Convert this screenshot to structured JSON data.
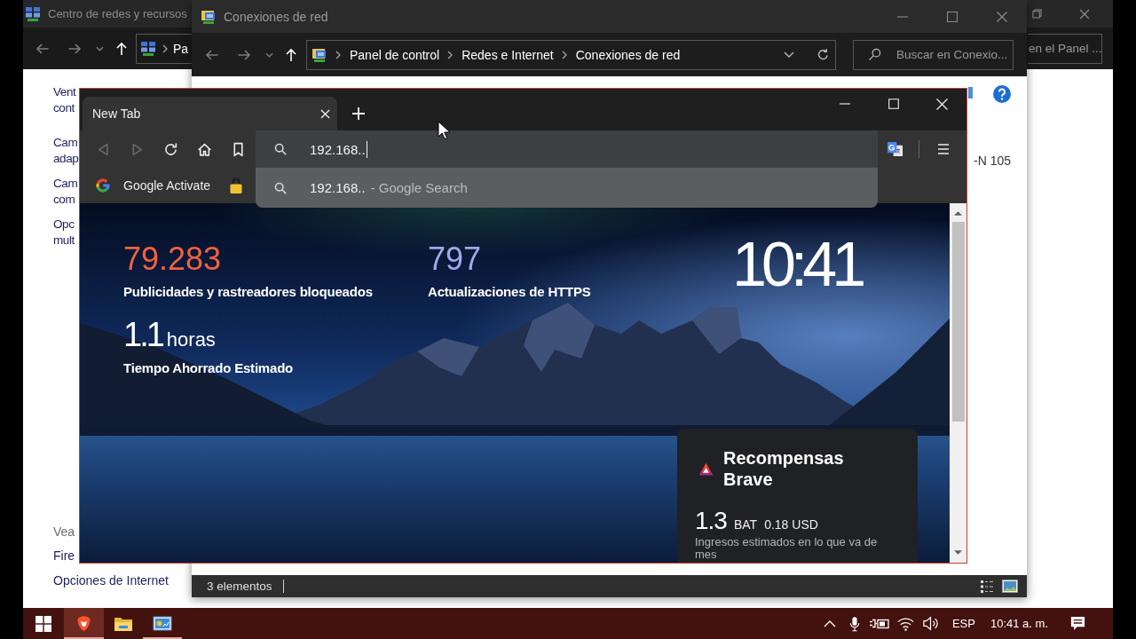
{
  "network_center_window": {
    "title": "Centro de redes y recursos",
    "nav": [
      {
        "kind": "back",
        "disabled": true
      },
      {
        "kind": "forward",
        "disabled": true
      },
      {
        "kind": "recent",
        "disabled": true
      },
      {
        "kind": "up",
        "disabled": false
      }
    ],
    "breadcrumb": [
      "Pa"
    ],
    "search_placeholder": "en el Panel ...",
    "links": [
      {
        "lines": [
          "Vent",
          "cont"
        ]
      },
      {
        "lines": [
          "Cam",
          "adap"
        ]
      },
      {
        "lines": [
          "Cam",
          "com"
        ]
      },
      {
        "lines": [
          "Opc",
          "mult"
        ]
      }
    ],
    "see_also": {
      "heading": "Vea",
      "links": [
        "Fire",
        "Opciones de Internet"
      ]
    }
  },
  "connections_window": {
    "title": "Conexiones de red",
    "nav": [
      {
        "kind": "back",
        "disabled": true
      },
      {
        "kind": "forward",
        "disabled": true
      },
      {
        "kind": "recent",
        "disabled": true
      },
      {
        "kind": "up",
        "disabled": false
      }
    ],
    "breadcrumb": [
      "Panel de control",
      "Redes e Internet",
      "Conexiones de red"
    ],
    "search_placeholder": "Buscar en Conexio...",
    "item_text": "-N 105",
    "status": "3 elementos"
  },
  "browser": {
    "tabs": [
      {
        "label": "New Tab",
        "selected": true
      }
    ],
    "toolbar": [
      {
        "kind": "back",
        "disabled": true
      },
      {
        "kind": "forward",
        "disabled": true
      },
      {
        "kind": "reload",
        "disabled": false
      },
      {
        "kind": "home",
        "disabled": false
      },
      {
        "kind": "bookmark",
        "disabled": false
      }
    ],
    "address": {
      "value": "192.168.."
    },
    "suggestions": [
      {
        "query": "192.168..",
        "source": "- Google Search"
      }
    ],
    "bookmarks": [
      {
        "kind": "google",
        "label": "Google Activate"
      },
      {
        "kind": "lock"
      }
    ],
    "new_tab_page": {
      "stats": [
        {
          "value": "79.283",
          "label": "Publicidades y rastreadores bloqueados",
          "color": "#f0613f"
        },
        {
          "value": "797",
          "label": "Actualizaciones de HTTPS",
          "color": "#a3a7e8"
        }
      ],
      "time_saved": {
        "value": "1.1",
        "unit": "horas",
        "label": "Tiempo Ahorrado Estimado"
      },
      "clock": "10:41",
      "rewards": {
        "title": "Recompensas Brave",
        "balance": "1.3",
        "currency": "BAT",
        "fiat": "0.18 USD",
        "note": "Ingresos estimados en lo que va de mes"
      }
    }
  },
  "taskbar": {
    "apps": [
      {
        "kind": "brave",
        "active": true,
        "running": true
      },
      {
        "kind": "explorer",
        "active": false,
        "running": false
      },
      {
        "kind": "control-panel",
        "active": false,
        "running": true
      }
    ],
    "language": "ESP",
    "time": "10:41 a. m."
  }
}
